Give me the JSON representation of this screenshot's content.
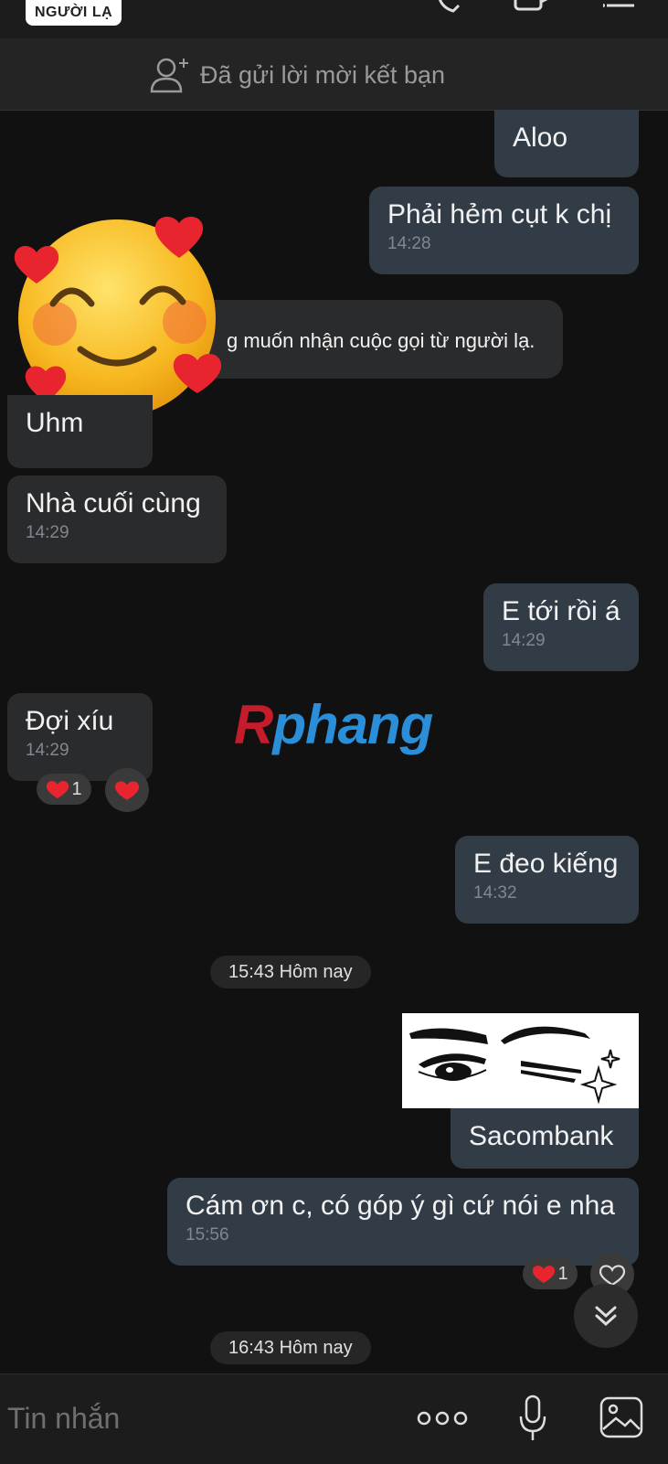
{
  "header": {
    "badge": "NGƯỜI LẠ"
  },
  "friend_request": {
    "text": "Đã gửi lời mời kết bạn",
    "icon": "add-friend-icon"
  },
  "messages": [
    {
      "text": "Aloo",
      "time": ""
    },
    {
      "text": "Phải hẻm cụt k chị",
      "time": "14:28"
    },
    {
      "text": "g muốn nhận cuộc gọi từ người lạ."
    },
    {
      "text": "Uhm",
      "time": ""
    },
    {
      "text": "Nhà cuối cùng",
      "time": "14:29"
    },
    {
      "text": "E tới rồi á",
      "time": "14:29"
    },
    {
      "text": "Đợi xíu",
      "time": "14:29"
    },
    {
      "text": "E đeo kiếng",
      "time": "14:32"
    },
    {
      "text": "Sacombank",
      "time": ""
    },
    {
      "text": "Cám ơn c, có góp ý gì cứ nói e nha",
      "time": "15:56"
    }
  ],
  "dates": {
    "d1": "15:43 Hôm nay",
    "d2": "16:43 Hôm nay"
  },
  "reactions": {
    "r1_count": "1",
    "r2_count": "1"
  },
  "watermark": {
    "r": "R",
    "rest": "phang"
  },
  "composer": {
    "placeholder": "Tin nhắn"
  },
  "colors": {
    "background": "#111111",
    "incoming": "#2a2b2d",
    "outgoing": "#323c47",
    "heart": "#e8252e"
  }
}
